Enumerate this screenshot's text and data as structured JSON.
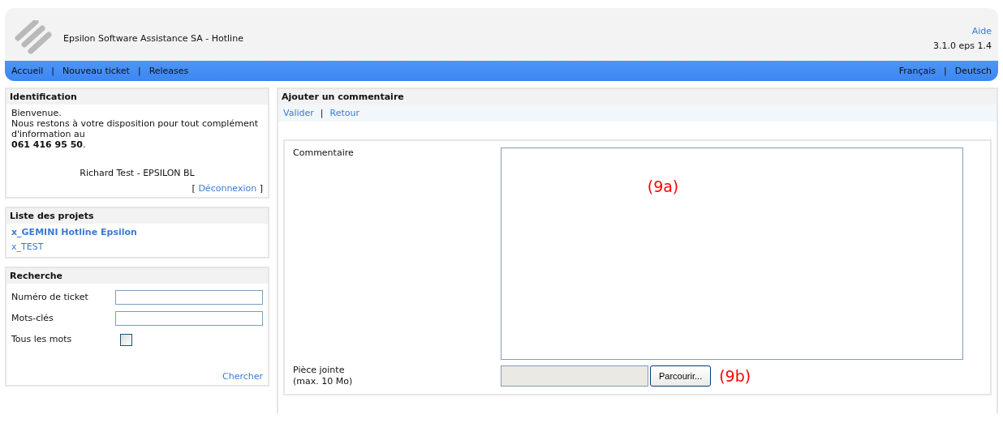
{
  "header": {
    "title": "Epsilon Software Assistance SA - Hotline",
    "help_link": "Aide",
    "version": "3.1.0 eps 1.4"
  },
  "nav": {
    "left": [
      "Accueil",
      "Nouveau ticket",
      "Releases"
    ],
    "right": [
      "Français",
      "Deutsch"
    ],
    "separator": "|"
  },
  "identification": {
    "title": "Identification",
    "welcome": "Bienvenue.",
    "message": "Nous restons à votre disposition pour tout complément d'information au",
    "phone": "**061 416 95 50**.",
    "user": "Richard Test - EPSILON BL",
    "logout_open": "[",
    "logout": "Déconnexion",
    "logout_close": "]"
  },
  "projects": {
    "title": "Liste des projets",
    "items": [
      {
        "label": "x_GEMINI Hotline Epsilon",
        "selected": true
      },
      {
        "label": "x_TEST",
        "selected": false
      }
    ]
  },
  "search": {
    "title": "Recherche",
    "fields": [
      {
        "label": "Numéro de ticket",
        "kind": "text"
      },
      {
        "label": "Mots-clés",
        "kind": "text"
      },
      {
        "label": "Tous les mots",
        "kind": "checkbox",
        "checked": false
      }
    ],
    "button": "Chercher"
  },
  "comment_panel": {
    "title": "Ajouter un commentaire",
    "actions": [
      "Valider",
      "Retour"
    ],
    "separator": "|",
    "comment_label": "Commentaire",
    "comment_annotation": "(9a)",
    "attachment_label": "Pièce jointe",
    "attachment_hint": "(max. 10 Mo)",
    "browse_button": "Parcourir...",
    "attachment_annotation": "(9b)"
  }
}
